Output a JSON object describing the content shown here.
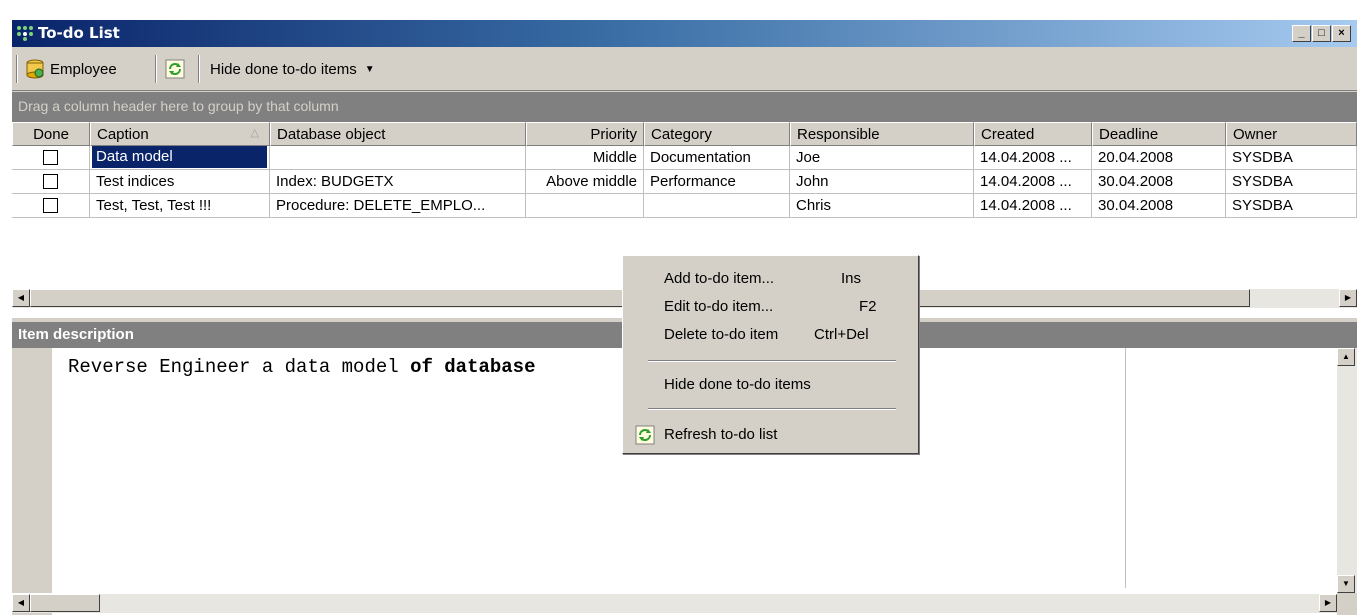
{
  "window": {
    "title": "To-do List"
  },
  "toolbar": {
    "employee_label": "Employee",
    "hide_done_label": "Hide done to-do items"
  },
  "group_panel": {
    "hint": "Drag a column header here to group by that column"
  },
  "grid": {
    "columns": [
      "Done",
      "Caption",
      "Database object",
      "Priority",
      "Category",
      "Responsible",
      "Created",
      "Deadline",
      "Owner"
    ],
    "rows": [
      {
        "done": false,
        "caption": "Data model",
        "object": "",
        "priority": "Middle",
        "category": "Documentation",
        "responsible": "Joe",
        "created": "14.04.2008 ...",
        "deadline": "20.04.2008",
        "owner": "SYSDBA"
      },
      {
        "done": false,
        "caption": "Test indices",
        "object": "Index: BUDGETX",
        "priority": "Above middle",
        "category": "Performance",
        "responsible": "John",
        "created": "14.04.2008 ...",
        "deadline": "30.04.2008",
        "owner": "SYSDBA"
      },
      {
        "done": false,
        "caption": "Test, Test, Test !!!",
        "object": "Procedure: DELETE_EMPLO...",
        "priority": "",
        "category": "",
        "responsible": "Chris",
        "created": "14.04.2008 ...",
        "deadline": "30.04.2008",
        "owner": "SYSDBA"
      }
    ]
  },
  "description": {
    "header": "Item description",
    "text_normal": "Reverse Engineer a data model ",
    "text_bold": "of database"
  },
  "context_menu": {
    "items": [
      {
        "label": "Add to-do item...",
        "shortcut": "Ins"
      },
      {
        "label": "Edit to-do item...",
        "shortcut": "F2"
      },
      {
        "label": "Delete to-do item",
        "shortcut": "Ctrl+Del"
      },
      {
        "label": "Hide done to-do items",
        "shortcut": ""
      },
      {
        "label": "Refresh to-do list",
        "shortcut": ""
      }
    ]
  },
  "colors": {
    "selection": "#0a246a",
    "title_start": "#0a246a",
    "title_end": "#a6caf0",
    "panel_gray": "#808080"
  }
}
